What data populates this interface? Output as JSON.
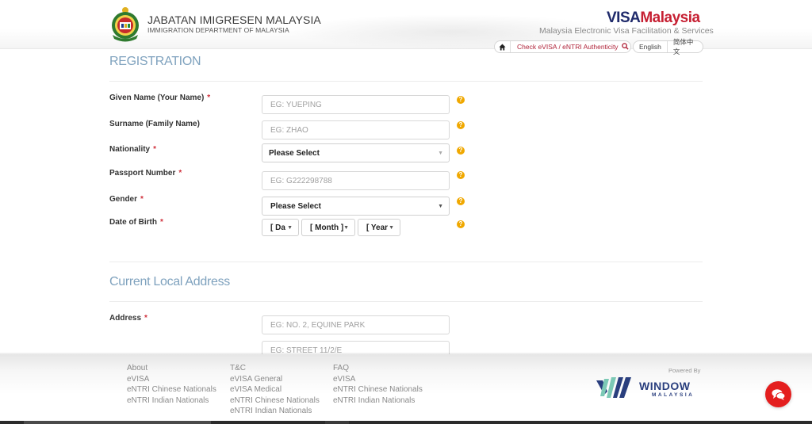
{
  "header": {
    "dept_title": "JABATAN IMIGRESEN MALAYSIA",
    "dept_subtitle": "IMMIGRATION DEPARTMENT OF MALAYSIA",
    "brand_visa": "VISA",
    "brand_malaysia": "Malaysia",
    "brand_tagline": "Malaysia Electronic Visa Facilitation & Services",
    "auth_link": "Check eVISA / eNTRI Authenticity",
    "lang_english": "English",
    "lang_chinese": "简体中文",
    "colors": {
      "brand_red": "#c62033",
      "brand_navy": "#1f2a6b"
    }
  },
  "registration": {
    "title": "REGISTRATION",
    "fields": [
      {
        "label": "Given Name (Your Name)",
        "required": "*",
        "placeholder": "EG: YUEPING",
        "type": "text"
      },
      {
        "label": "Surname (Family Name)",
        "required": "",
        "placeholder": "EG: ZHAO",
        "type": "text"
      },
      {
        "label": "Nationality",
        "required": "*",
        "value": "Please Select",
        "type": "select"
      },
      {
        "label": "Passport Number",
        "required": "*",
        "placeholder": "EG: G222298788",
        "type": "text"
      },
      {
        "label": "Gender",
        "required": "*",
        "value": "Please Select",
        "type": "select"
      },
      {
        "label": "Date of Birth",
        "required": "*",
        "type": "date",
        "day": "[ Da",
        "month": "[ Month ]",
        "year": "[ Year"
      }
    ]
  },
  "address": {
    "title": "Current Local Address",
    "label": "Address",
    "required": "*",
    "line1_placeholder": "EG: NO. 2, EQUINE PARK",
    "line2_placeholder": "EG: STREET 11/2/E"
  },
  "footer": {
    "columns": [
      {
        "heading": "About",
        "links": [
          "eVISA",
          "eNTRI Chinese Nationals",
          "eNTRI Indian Nationals"
        ]
      },
      {
        "heading": "T&C",
        "links": [
          "eVISA General",
          "eVISA Medical",
          "eNTRI Chinese Nationals",
          "eNTRI Indian Nationals"
        ]
      },
      {
        "heading": "FAQ",
        "links": [
          "eVISA",
          "eNTRI Chinese Nationals",
          "eNTRI Indian Nationals"
        ]
      }
    ],
    "powered_by": "Powered By",
    "partner_name": "WINDOW",
    "partner_sub": "MALAYSIA",
    "chat_icon": "chat-bubbles-icon"
  }
}
